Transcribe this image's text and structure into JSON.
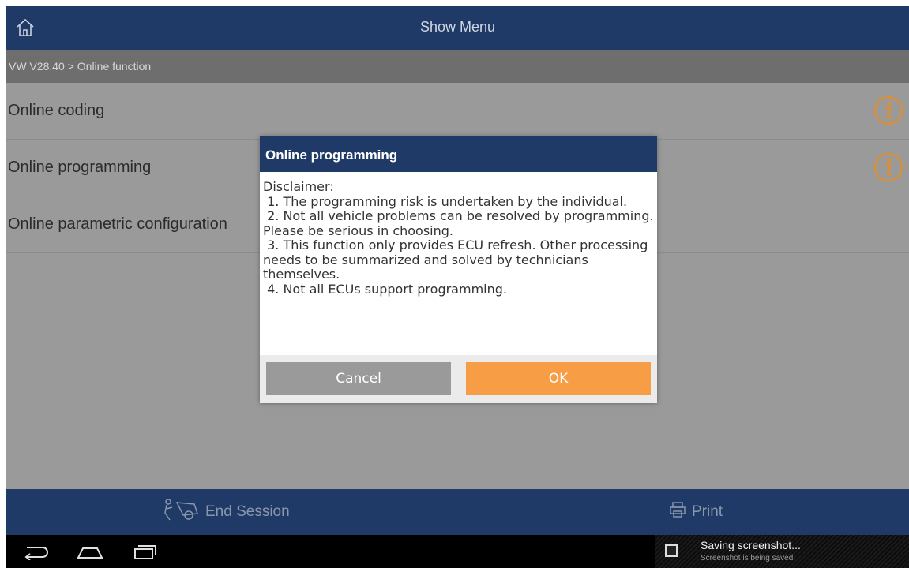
{
  "header": {
    "title": "Show Menu",
    "home_icon": "home-icon"
  },
  "breadcrumb": "VW V28.40 > Online function",
  "list": {
    "items": [
      {
        "label": "Online coding",
        "info_icon": "info-icon"
      },
      {
        "label": "Online programming",
        "info_icon": "info-icon"
      },
      {
        "label": "Online parametric configuration"
      }
    ]
  },
  "dialog": {
    "title": "Online programming",
    "body": "Disclaimer:\n 1. The programming risk is undertaken by the individual.\n 2. Not all vehicle problems can be resolved by programming. Please be serious in choosing.\n 3. This function only provides ECU refresh. Other processing needs to be summarized and solved by technicians themselves.\n 4. Not all ECUs support programming.",
    "cancel_label": "Cancel",
    "ok_label": "OK"
  },
  "footer": {
    "end_session_label": "End Session",
    "print_label": "Print"
  },
  "notification": {
    "title": "Saving screenshot...",
    "subtitle": "Screenshot is being saved."
  },
  "colors": {
    "header": "#1f3a66",
    "ok_button": "#f79d46",
    "info_icon": "#d9903a"
  }
}
